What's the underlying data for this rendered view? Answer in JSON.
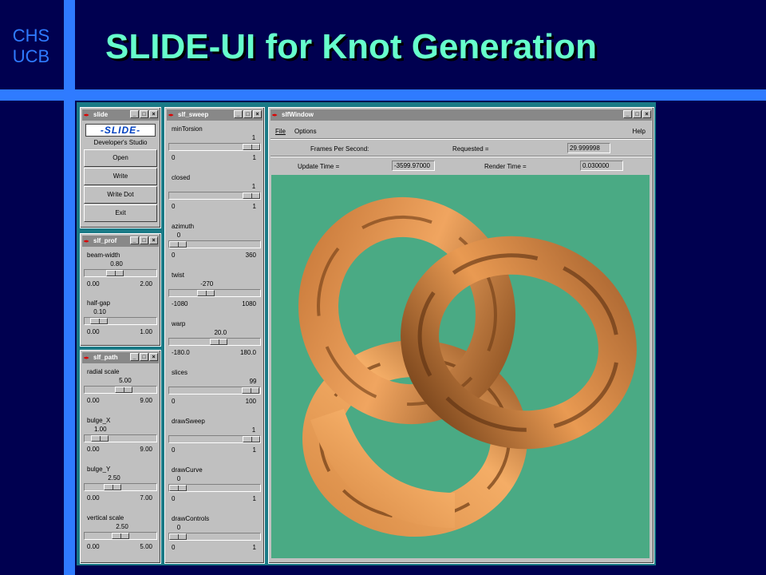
{
  "slide": {
    "corner_line1": "CHS",
    "corner_line2": "UCB",
    "title": "SLIDE-UI  for Knot Generation"
  },
  "win_slide": {
    "title": "slide",
    "logo": "-SLIDE-",
    "subtitle": "Developer's Studio",
    "buttons": [
      "Open",
      "Write",
      "Write Dot",
      "Exit"
    ]
  },
  "win_prof": {
    "title": "slf_prof",
    "sliders": [
      {
        "label": "beam-width",
        "value": "0.80",
        "min": "0.00",
        "max": "2.00",
        "fraction": 0.4
      },
      {
        "label": "half-gap",
        "value": "0.10",
        "min": "0.00",
        "max": "1.00",
        "fraction": 0.1
      }
    ]
  },
  "win_path": {
    "title": "slf_path",
    "sliders": [
      {
        "label": "radial scale",
        "value": "5.00",
        "min": "0.00",
        "max": "9.00",
        "fraction": 0.556
      },
      {
        "label": "bulge_X",
        "value": "1.00",
        "min": "0.00",
        "max": "9.00",
        "fraction": 0.111
      },
      {
        "label": "bulge_Y",
        "value": "2.50",
        "min": "0.00",
        "max": "7.00",
        "fraction": 0.357
      },
      {
        "label": "vertical scale",
        "value": "2.50",
        "min": "0.00",
        "max": "5.00",
        "fraction": 0.5
      }
    ]
  },
  "win_sweep": {
    "title": "slf_sweep",
    "sliders": [
      {
        "label": "minTorsion",
        "value": "1",
        "min": "0",
        "max": "1",
        "fraction": 1.0
      },
      {
        "label": "closed",
        "value": "1",
        "min": "0",
        "max": "1",
        "fraction": 1.0
      },
      {
        "label": "azimuth",
        "value": "0",
        "min": "0",
        "max": "360",
        "fraction": 0.0
      },
      {
        "label": "twist",
        "value": "-270",
        "min": "-1080",
        "max": "1080",
        "fraction": 0.375
      },
      {
        "label": "warp",
        "value": "20.0",
        "min": "-180.0",
        "max": "180.0",
        "fraction": 0.556
      },
      {
        "label": "slices",
        "value": "99",
        "min": "0",
        "max": "100",
        "fraction": 0.99
      },
      {
        "label": "drawSweep",
        "value": "1",
        "min": "0",
        "max": "1",
        "fraction": 1.0
      },
      {
        "label": "drawCurve",
        "value": "0",
        "min": "0",
        "max": "1",
        "fraction": 0.0
      },
      {
        "label": "drawControls",
        "value": "0",
        "min": "0",
        "max": "1",
        "fraction": 0.0
      }
    ]
  },
  "win_main": {
    "title": "slfWindow",
    "menu": [
      "File",
      "Options"
    ],
    "help": "Help",
    "fps_label": "Frames Per Second:",
    "requested_label": "Requested =",
    "requested_value": "29.999998",
    "update_label": "Update Time =",
    "update_value": "-3599.97000",
    "render_label": "Render Time =",
    "render_value": "0.030000"
  },
  "colors": {
    "background": "#000050",
    "accent_bar": "#2f7bff",
    "title": "#66ffcc",
    "viewport": "#4aaa84",
    "knot": "#e89a50"
  },
  "icons": {
    "window_icon": "tk-feather-icon",
    "minimize": "minimize-icon",
    "maximize": "maximize-icon",
    "close": "close-icon"
  }
}
